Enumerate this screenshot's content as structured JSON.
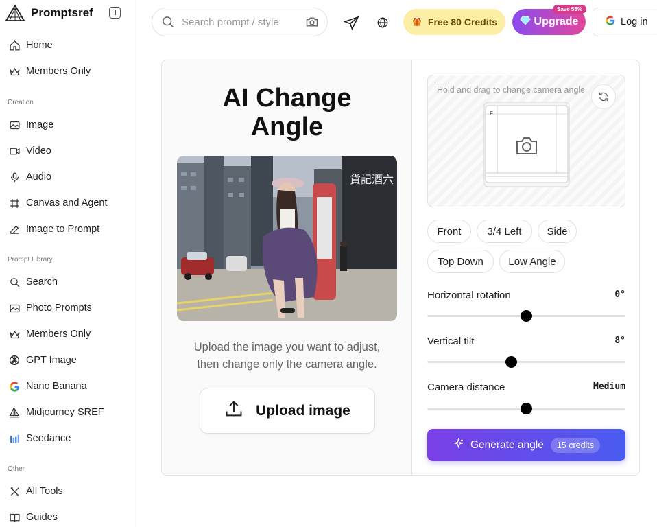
{
  "app": {
    "name": "Promptsref"
  },
  "sidebar": {
    "top_items": [
      {
        "label": "Home",
        "icon": "home-icon"
      },
      {
        "label": "Members Only",
        "icon": "crown-icon"
      }
    ],
    "sections": [
      {
        "title": "Creation",
        "items": [
          {
            "label": "Image",
            "icon": "image-icon"
          },
          {
            "label": "Video",
            "icon": "video-icon"
          },
          {
            "label": "Audio",
            "icon": "microphone-icon"
          },
          {
            "label": "Canvas and Agent",
            "icon": "frame-icon"
          },
          {
            "label": "Image to Prompt",
            "icon": "edit-icon"
          }
        ]
      },
      {
        "title": "Prompt Library",
        "items": [
          {
            "label": "Search",
            "icon": "search-icon"
          },
          {
            "label": "Photo Prompts",
            "icon": "image-icon"
          },
          {
            "label": "Members Only",
            "icon": "crown-icon"
          },
          {
            "label": "GPT Image",
            "icon": "openai-icon"
          },
          {
            "label": "Nano Banana",
            "icon": "google-icon"
          },
          {
            "label": "Midjourney SREF",
            "icon": "sailboat-icon"
          },
          {
            "label": "Seedance",
            "icon": "bars-icon"
          }
        ]
      },
      {
        "title": "Other",
        "items": [
          {
            "label": "All Tools",
            "icon": "tools-icon"
          },
          {
            "label": "Guides",
            "icon": "book-icon"
          }
        ]
      }
    ]
  },
  "header": {
    "search_placeholder": "Search prompt / style",
    "credits_label": "Free 80 Credits",
    "upgrade_label": "Upgrade",
    "save_badge": "Save 55%",
    "login_label": "Log in"
  },
  "tool": {
    "title_line1": "AI Change",
    "title_line2": "Angle",
    "description_line1": "Upload the image you want to adjust,",
    "description_line2": "then change only the camera angle.",
    "upload_label": "Upload image",
    "stage_hint": "Hold and drag to change camera angle",
    "cube_face_letter": "F",
    "presets": [
      "Front",
      "3/4 Left",
      "Side",
      "Top Down",
      "Low Angle"
    ],
    "controls": [
      {
        "label": "Horizontal rotation",
        "value": "0°",
        "fraction": 0.5
      },
      {
        "label": "Vertical tilt",
        "value": "8°",
        "fraction": 0.425
      },
      {
        "label": "Camera distance",
        "value": "Medium",
        "fraction": 0.5
      }
    ],
    "generate_label": "Generate angle",
    "generate_cost": "15 credits"
  },
  "colors": {
    "credits_bg": "#fdeea6",
    "upgrade_gradient": [
      "#8a4bf0",
      "#e2479a"
    ],
    "generate_gradient": [
      "#7a3fe6",
      "#4a5cf0"
    ]
  }
}
